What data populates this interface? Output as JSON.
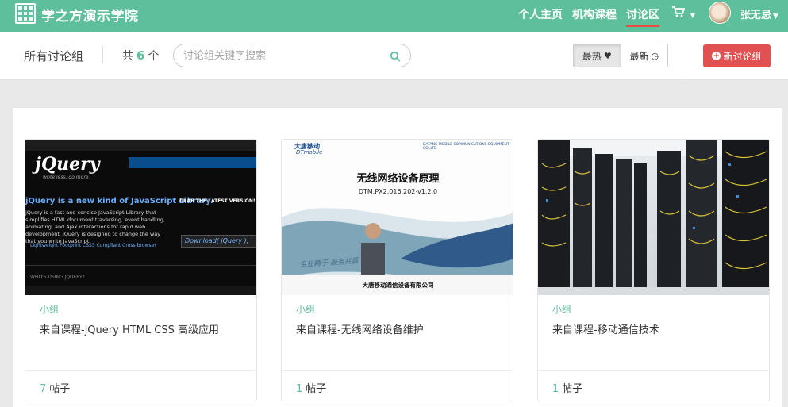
{
  "brand": {
    "name": "学之方演示学院"
  },
  "nav": {
    "items": [
      {
        "label": "个人主页",
        "active": false
      },
      {
        "label": "机构课程",
        "active": false
      },
      {
        "label": "讨论区",
        "active": true
      }
    ],
    "cart_icon": "shopping-cart-icon",
    "username": "张无忌"
  },
  "toolbar": {
    "title": "所有讨论组",
    "count_prefix": "共",
    "count": "6",
    "count_suffix": "个",
    "search_placeholder": "讨论组关键字搜索",
    "sort_hot": "最热",
    "sort_new": "最新",
    "new_button": "新讨论组"
  },
  "colors": {
    "primary": "#5dbf9b",
    "danger": "#e15151"
  },
  "groups": [
    {
      "category": "小组",
      "title": "来自课程-jQuery HTML CSS 高级应用",
      "posts": "7",
      "posts_label": "帖子",
      "thumb": {
        "logo": "jQuery",
        "tagline": "write less, do more.",
        "headline": "jQuery is a new kind of JavaScript Library.",
        "body": "jQuery is a fast and concise JavaScript Library that simplifies HTML document traversing, event handling, animating, and Ajax interactions for rapid web development. jQuery is designed to change the way that you write JavaScript.",
        "grab": "GRAB THE LATEST VERSION!",
        "download": "Download( jQuery );",
        "links": "Lightweight Footprint    CSS3 Compliant    Cross-browser",
        "who": "WHO'S USING JQUERY?"
      }
    },
    {
      "category": "小组",
      "title": "来自课程-无线网络设备维护",
      "posts": "1",
      "posts_label": "帖子",
      "thumb": {
        "logo": "大唐移动",
        "logo_sub": "DTmobile",
        "company_en": "DATANG MOBILE COMMUNICATIONS EQUIPMENT CO.,LTD",
        "slide_title": "无线网络设备原理",
        "slide_code": "DTM.PX2.016.202-v1.2.0",
        "slogan": "专业精于 服务共赢",
        "company": "大唐移动通信设备有限公司"
      }
    },
    {
      "category": "小组",
      "title": "来自课程-移动通信技术",
      "posts": "1",
      "posts_label": "帖子"
    }
  ]
}
